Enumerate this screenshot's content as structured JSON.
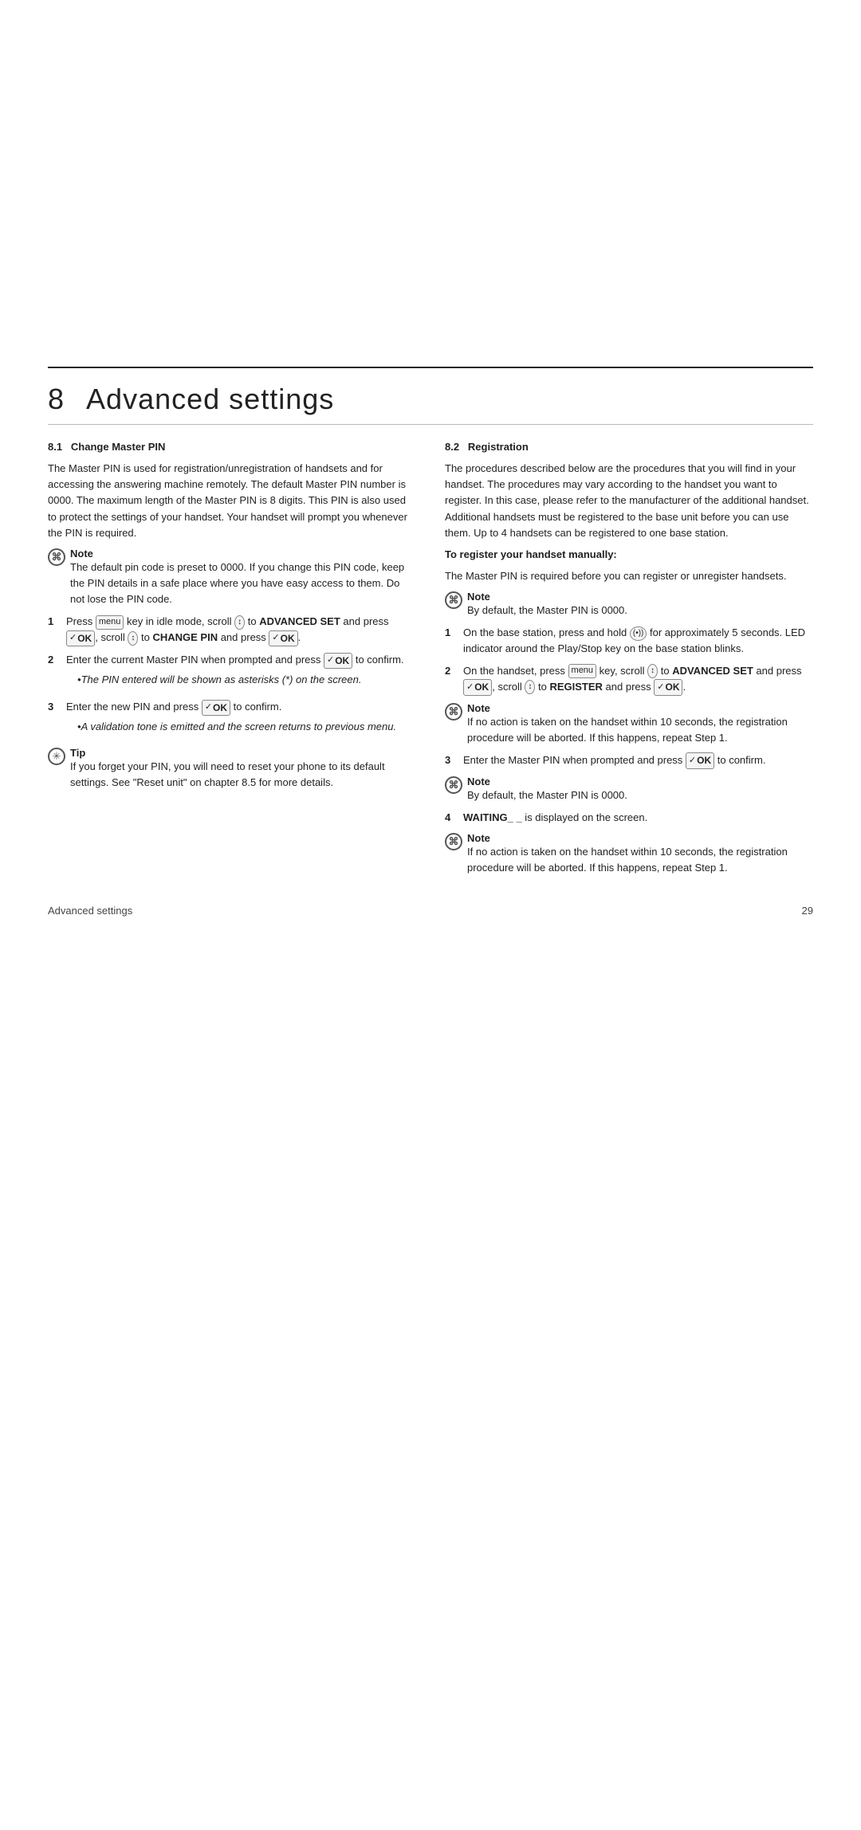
{
  "page": {
    "top_blank_height": 460,
    "chapter_number": "8",
    "chapter_title": "Advanced settings",
    "divider_top": true,
    "footer_left": "Advanced settings",
    "footer_right": "29"
  },
  "left_col": {
    "section_81": {
      "number": "8.1",
      "title": "Change Master PIN",
      "intro": "The Master PIN is used for  registration/unregistration of handsets and for accessing the answering machine remotely. The default Master PIN number is 0000. The maximum length of the Master PIN is 8 digits. This PIN is also used to protect the settings of your handset. Your handset will prompt you whenever the PIN is required."
    },
    "note1": {
      "label": "Note",
      "text": "The default pin code is preset to 0000. If you change this PIN code, keep the PIN details in a safe place where you have easy access to them. Do not lose the PIN code."
    },
    "steps": [
      {
        "num": "1",
        "text_parts": [
          {
            "type": "text",
            "content": "Press "
          },
          {
            "type": "key",
            "content": "menu"
          },
          {
            "type": "text",
            "content": " key in idle mode, scroll "
          },
          {
            "type": "key",
            "content": "↕"
          },
          {
            "type": "text",
            "content": " to "
          },
          {
            "type": "bold",
            "content": "ADVANCED SET"
          },
          {
            "type": "text",
            "content": " and press "
          },
          {
            "type": "ok",
            "content": "✓OK"
          },
          {
            "type": "text",
            "content": ", scroll "
          },
          {
            "type": "key",
            "content": "↕"
          },
          {
            "type": "text",
            "content": " to "
          },
          {
            "type": "bold",
            "content": "CHANGE PIN"
          },
          {
            "type": "text",
            "content": " and press "
          },
          {
            "type": "ok",
            "content": "✓OK"
          },
          {
            "type": "text",
            "content": "."
          }
        ],
        "rendered": "Press <menu> key in idle mode, scroll <↕> to ADVANCED SET and press ✓OK, scroll <↕> to CHANGE PIN and press ✓OK."
      },
      {
        "num": "2",
        "rendered": "Enter the current Master PIN when prompted and press ✓OK to confirm.",
        "bullet": "The PIN entered will be shown as asterisks (*) on the screen."
      },
      {
        "num": "3",
        "rendered": "Enter the new PIN and press ✓OK to confirm.",
        "bullet": "A validation tone is emitted and the screen returns to previous menu."
      }
    ],
    "tip": {
      "label": "Tip",
      "text": "If you forget your PIN, you will need to reset your phone to its default settings. See \"Reset unit\" on chapter 8.5 for more details."
    }
  },
  "right_col": {
    "section_82": {
      "number": "8.2",
      "title": "Registration",
      "intro": "The procedures described below are the procedures that you will find in your handset. The procedures may vary according to the handset you want to register. In this case, please refer to the manufacturer of the additional handset. Additional handsets must be registered to the base unit before you can use them. Up to 4 handsets can be registered to one base station."
    },
    "register_heading": "To register your handset manually:",
    "register_intro": "The Master PIN is required before you can register or unregister handsets.",
    "note2": {
      "label": "Note",
      "text": "By default, the Master PIN is 0000."
    },
    "steps": [
      {
        "num": "1",
        "rendered": "On the base station, press and hold <(•))> for approximately 5 seconds. LED indicator around the Play/Stop key on the base station blinks."
      },
      {
        "num": "2",
        "rendered": "On the handset, press <menu> key, scroll <↕> to ADVANCED SET and press ✓OK, scroll <↕> to REGISTER and press ✓OK."
      }
    ],
    "note3": {
      "label": "Note",
      "text": "If no action is taken on the handset within 10 seconds, the registration procedure will be aborted. If this happens, repeat Step 1."
    },
    "steps2": [
      {
        "num": "3",
        "rendered": "Enter the Master PIN when prompted and press ✓OK to confirm."
      }
    ],
    "note4": {
      "label": "Note",
      "text": "By default, the Master PIN is 0000."
    },
    "steps3": [
      {
        "num": "4",
        "rendered": "WAITING_ _ is displayed on the screen."
      }
    ],
    "note5": {
      "label": "Note",
      "text": "If no action is taken on the handset within 10 seconds, the registration procedure will be aborted. If this happens, repeat Step 1."
    }
  }
}
